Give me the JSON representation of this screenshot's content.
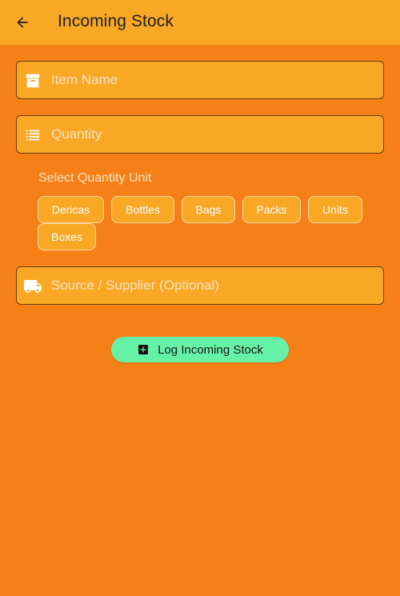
{
  "appbar": {
    "title": "Incoming Stock",
    "back_icon": "arrow-back-icon"
  },
  "form": {
    "item_name": {
      "placeholder": "Item Name",
      "value": "",
      "icon": "archive-box-icon"
    },
    "quantity": {
      "placeholder": "Quantity",
      "value": "",
      "icon": "list-icon"
    },
    "unit_label": "Select Quantity Unit",
    "units": [
      "Dericas",
      "Bottles",
      "Bags",
      "Packs",
      "Units",
      "Boxes"
    ],
    "source": {
      "placeholder": "Source / Supplier (Optional)",
      "value": "",
      "icon": "truck-icon"
    }
  },
  "action": {
    "label": "Log Incoming Stock",
    "icon": "add-box-icon"
  },
  "colors": {
    "background": "#f58017",
    "appbar": "#f9a826",
    "field": "#f9a826",
    "button": "#66f2a6"
  }
}
